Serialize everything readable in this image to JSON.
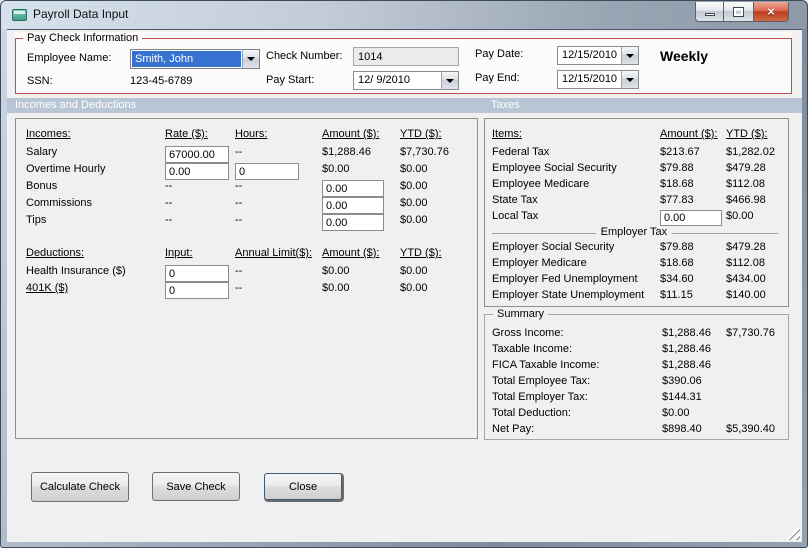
{
  "window": {
    "title": "Payroll Data Input",
    "close_glyph": "×"
  },
  "paycheck_info": {
    "group_label": "Pay Check Information",
    "employee_name_label": "Employee Name:",
    "employee_name_value": "Smith, John",
    "ssn_label": "SSN:",
    "ssn_value": "123-45-6789",
    "check_number_label": "Check Number:",
    "check_number_value": "1014",
    "pay_start_label": "Pay Start:",
    "pay_start_value": "12/ 9/2010",
    "pay_date_label": "Pay Date:",
    "pay_date_value": "12/15/2010",
    "pay_end_label": "Pay End:",
    "pay_end_value": "12/15/2010",
    "frequency": "Weekly"
  },
  "sections": {
    "incomes_deductions_header": "Incomes and Deductions",
    "taxes_header": "Taxes"
  },
  "incomes": {
    "headers": {
      "name": "Incomes:",
      "rate": "Rate ($):",
      "hours": "Hours:",
      "amount": "Amount ($):",
      "ytd": "YTD ($):"
    },
    "rows": [
      {
        "name": "Salary",
        "rate": "67000.00",
        "hours": "--",
        "amount": "$1,288.46",
        "ytd": "$7,730.76"
      },
      {
        "name": "Overtime Hourly",
        "rate": "0.00",
        "hours": "0",
        "amount": "$0.00",
        "ytd": "$0.00"
      },
      {
        "name": "Bonus",
        "rate": "--",
        "hours": "--",
        "amount": "0.00",
        "ytd": "$0.00"
      },
      {
        "name": "Commissions",
        "rate": "--",
        "hours": "--",
        "amount": "0.00",
        "ytd": "$0.00"
      },
      {
        "name": "Tips",
        "rate": "--",
        "hours": "--",
        "amount": "0.00",
        "ytd": "$0.00"
      }
    ]
  },
  "deductions": {
    "headers": {
      "name": "Deductions:",
      "input": "Input:",
      "annual_limit": "Annual Limit($):",
      "amount": "Amount ($):",
      "ytd": "YTD ($):"
    },
    "rows": [
      {
        "name": "Health Insurance  ($)",
        "input": "0",
        "annual_limit": "--",
        "amount": "$0.00",
        "ytd": "$0.00"
      },
      {
        "name": "401K  ($)",
        "input": "0",
        "annual_limit": "--",
        "amount": "$0.00",
        "ytd": "$0.00"
      }
    ]
  },
  "taxes": {
    "headers": {
      "items": "Items:",
      "amount": "Amount ($):",
      "ytd": "YTD ($):"
    },
    "employee_rows": [
      {
        "name": "Federal Tax",
        "amount": "$213.67",
        "ytd": "$1,282.02"
      },
      {
        "name": "Employee Social Security",
        "amount": "$79.88",
        "ytd": "$479.28"
      },
      {
        "name": "Employee Medicare",
        "amount": "$18.68",
        "ytd": "$112.08"
      },
      {
        "name": "State Tax",
        "amount": "$77.83",
        "ytd": "$466.98"
      },
      {
        "name": "Local Tax",
        "amount": "0.00",
        "ytd": "$0.00"
      }
    ],
    "employer_group_label": "Employer Tax",
    "employer_rows": [
      {
        "name": "Employer Social Security",
        "amount": "$79.88",
        "ytd": "$479.28"
      },
      {
        "name": "Employer Medicare",
        "amount": "$18.68",
        "ytd": "$112.08"
      },
      {
        "name": "Employer Fed Unemployment",
        "amount": "$34.60",
        "ytd": "$434.00"
      },
      {
        "name": "Employer State Unemployment",
        "amount": "$11.15",
        "ytd": "$140.00"
      }
    ]
  },
  "summary": {
    "group_label": "Summary",
    "rows": [
      {
        "name": "Gross Income:",
        "amount": "$1,288.46",
        "ytd": "$7,730.76"
      },
      {
        "name": "Taxable Income:",
        "amount": "$1,288.46",
        "ytd": ""
      },
      {
        "name": "FICA Taxable Income:",
        "amount": "$1,288.46",
        "ytd": ""
      },
      {
        "name": "Total Employee Tax:",
        "amount": "$390.06",
        "ytd": ""
      },
      {
        "name": "Total Employer Tax:",
        "amount": "$144.31",
        "ytd": ""
      },
      {
        "name": "Total Deduction:",
        "amount": "$0.00",
        "ytd": ""
      },
      {
        "name": "Net Pay:",
        "amount": "$898.40",
        "ytd": "$5,390.40"
      }
    ]
  },
  "buttons": {
    "calculate": "Calculate Check",
    "save": "Save Check",
    "close": "Close"
  }
}
